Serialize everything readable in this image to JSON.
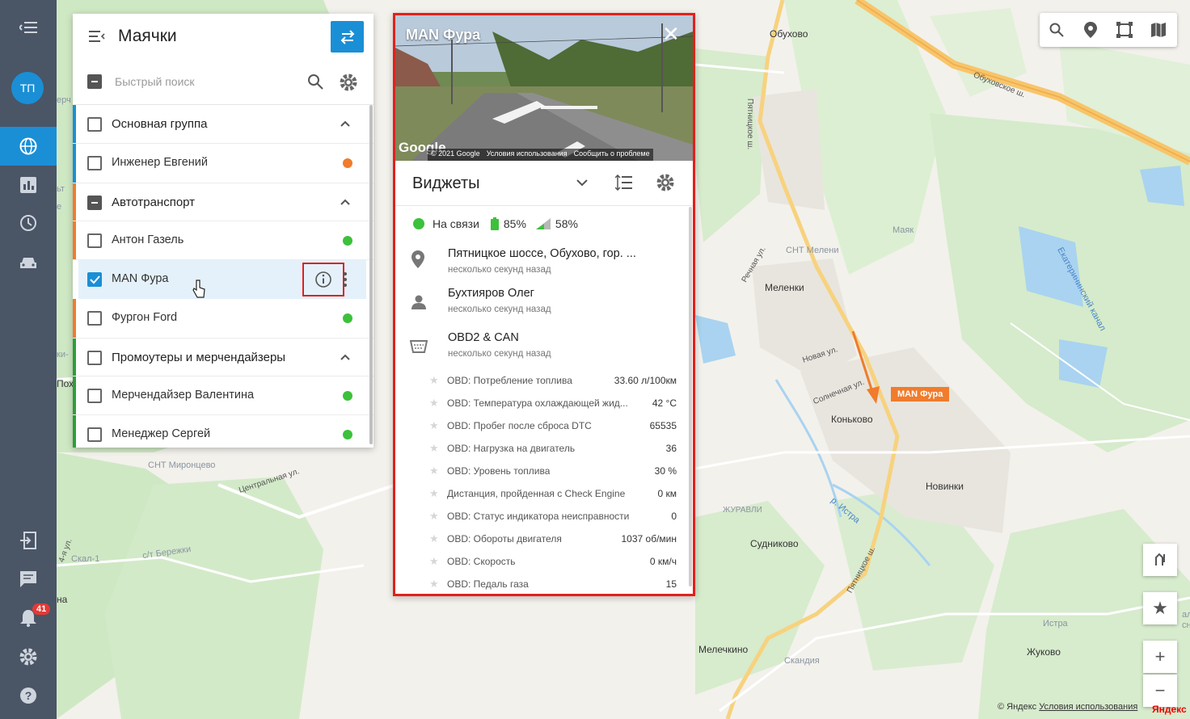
{
  "nav": {
    "avatar": "ТП",
    "notifications_count": "41",
    "items": [
      "menu-collapse-icon",
      "globe-icon",
      "chart-icon",
      "clock-icon",
      "car-icon",
      "logout-icon",
      "chat-icon",
      "bell-icon",
      "gear-icon",
      "help-icon"
    ]
  },
  "beacons": {
    "title": "Маячки",
    "search_placeholder": "Быстрый поиск",
    "groups": [
      {
        "name": "Основная группа",
        "color": "#1a8fd6",
        "items": [
          {
            "name": "Инженер Евгений",
            "status": "#f07c2c"
          }
        ]
      },
      {
        "name": "Автотранспорт",
        "color": "#f07c2c",
        "items": [
          {
            "name": "Антон Газель",
            "status": "#3cc13b"
          },
          {
            "name": "MAN Фура",
            "status": "",
            "selected": true
          },
          {
            "name": "Фургон Ford",
            "status": "#3cc13b"
          }
        ]
      },
      {
        "name": "Промоутеры и мерчендайзеры",
        "color": "#2e9e3a",
        "items": [
          {
            "name": "Мерчендайзер Валентина",
            "status": "#3cc13b"
          },
          {
            "name": "Менеджер Сергей",
            "status": "#3cc13b"
          }
        ]
      }
    ]
  },
  "card": {
    "title": "MAN Фура",
    "photo_brand": "Google",
    "photo_credits": [
      "© 2021 Google",
      "Условия использования",
      "Сообщить о проблеме"
    ],
    "widgets_title": "Виджеты",
    "status": {
      "online": "На связи",
      "battery": "85%",
      "signal": "58%"
    },
    "address": {
      "text": "Пятницкое шоссе, Обухово, гор. ...",
      "time": "несколько секунд назад"
    },
    "driver": {
      "text": "Бухтияров Олег",
      "time": "несколько секунд назад"
    },
    "obd": {
      "text": "OBD2 & CAN",
      "time": "несколько секунд назад"
    },
    "obd_params": [
      {
        "name": "OBD: Потребление топлива",
        "value": "33.60 л/100км"
      },
      {
        "name": "OBD: Температура охлаждающей жид...",
        "value": "42 °C"
      },
      {
        "name": "OBD: Пробег после сброса DTC",
        "value": "65535"
      },
      {
        "name": "OBD: Нагрузка на двигатель",
        "value": "36"
      },
      {
        "name": "OBD: Уровень топлива",
        "value": "30 %"
      },
      {
        "name": "Дистанция, пройденная с Check Engine",
        "value": "0 км"
      },
      {
        "name": "OBD: Статус индикатора неисправности",
        "value": "0"
      },
      {
        "name": "OBD: Обороты двигателя",
        "value": "1037 об/мин"
      },
      {
        "name": "OBD: Скорость",
        "value": "0 км/ч"
      },
      {
        "name": "OBD: Педаль газа",
        "value": "15"
      }
    ]
  },
  "map": {
    "labels": {
      "obukhovo": "Обухово",
      "meleniki": "Меленки",
      "konkovo": "Коньково",
      "novinki": "Новинки",
      "sudnikovo": "Судниково",
      "melechkino": "Мелечкино",
      "zhukovo": "Жуково",
      "snt_meleni": "СНТ Мелени",
      "snt_mironcevo": "СНТ Миронцево",
      "mayak": "Маяк",
      "zhuravli": "ЖУРАВЛИ",
      "istra_label": "Истра",
      "skandiya": "Скандия",
      "s_t_berezhki": "с/т Бережки",
      "skal": "Скал-1",
      "pyatnickoe_sh_top": "Пятницкое ш.",
      "pyatnickoe_sh_bottom": "Пятницкое ш.",
      "obukhovskoe_sh": "Обуховское ш.",
      "rechnaya": "Речная ул.",
      "novaya": "Новая ул.",
      "solnechnaya": "Солнечная ул.",
      "tsentralnaya": "Центральная ул.",
      "ul4": "4-я ул.",
      "r_istra": "р. Истра",
      "ekaterininsky": "Екатерининский канал",
      "left_1": "ерч",
      "left_2": "ьт",
      "left_3": "е",
      "left_4": "ки-",
      "left_5": "Пох",
      "left_6": "на",
      "right_1": "ала",
      "right_2": "сны"
    },
    "truck_label": "MAN Фура",
    "copyright": "© Яндекс",
    "terms": "Условия использования",
    "brand": "Яндекс",
    "zoom_in": "+",
    "zoom_out": "−"
  }
}
